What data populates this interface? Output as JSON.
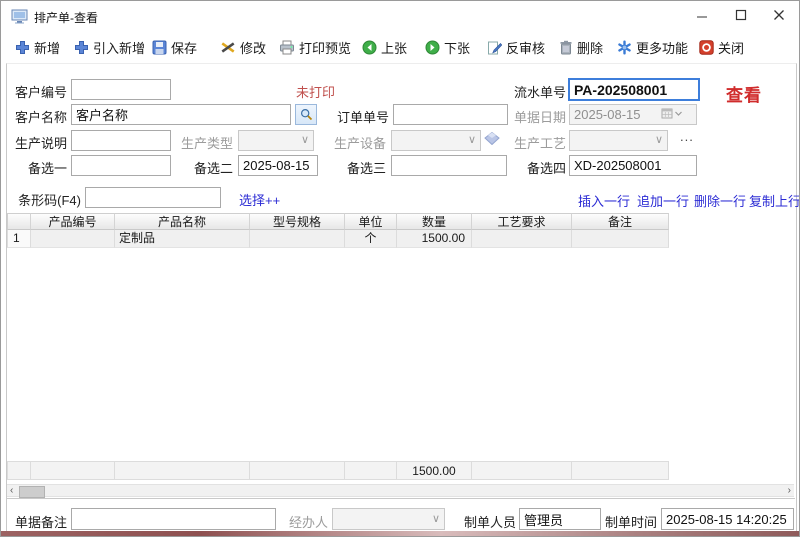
{
  "window": {
    "title": "排产单-查看"
  },
  "toolbar": {
    "items": [
      {
        "label": "新增"
      },
      {
        "label": "引入新增"
      },
      {
        "label": "保存"
      },
      {
        "label": "修改"
      },
      {
        "label": "打印预览"
      },
      {
        "label": "上张"
      },
      {
        "label": "下张"
      },
      {
        "label": "反审核"
      },
      {
        "label": "删除"
      },
      {
        "label": "更多功能"
      },
      {
        "label": "关闭"
      }
    ]
  },
  "status": {
    "not_printed": "未打印",
    "view_badge": "查看"
  },
  "form": {
    "customer_no_label": "客户编号",
    "customer_no_value": "",
    "customer_name_label": "客户名称",
    "customer_name_value": "客户名称",
    "order_no_label": "订单单号",
    "order_no_value": "",
    "serial_no_label": "流水单号",
    "serial_no_value": "PA-202508001",
    "doc_date_label": "单据日期",
    "doc_date_value": "2025-08-15",
    "prod_desc_label": "生产说明",
    "prod_desc_value": "",
    "prod_type_label": "生产类型",
    "prod_equip_label": "生产设备",
    "prod_craft_label": "生产工艺",
    "ellipsis_button": "...",
    "option1_label": "备选一",
    "option1_value": "",
    "option2_label": "备选二",
    "option2_value": "2025-08-15",
    "option3_label": "备选三",
    "option3_value": "",
    "option4_label": "备选四",
    "option4_value": "XD-202508001",
    "barcode_label": "条形码(F4)",
    "barcode_value": "",
    "select_plus_link": "选择++"
  },
  "row_links": {
    "insert": "插入一行",
    "append": "追加一行",
    "delete": "删除一行",
    "copy_up": "复制上行"
  },
  "table": {
    "columns": [
      "产品编号",
      "产品名称",
      "型号规格",
      "单位",
      "数量",
      "工艺要求",
      "备注"
    ],
    "rows": [
      {
        "no": "1",
        "code": "",
        "name": "定制品",
        "spec": "",
        "unit": "个",
        "qty": "1500.00",
        "craft": "",
        "remark": ""
      }
    ],
    "total_qty": "1500.00"
  },
  "footer": {
    "doc_remark_label": "单据备注",
    "doc_remark_value": "",
    "handler_label": "经办人",
    "handler_value": "",
    "creator_label": "制单人员",
    "creator_value": "管理员",
    "time_label": "制单时间",
    "time_value": "2025-08-15 14:20:25"
  },
  "colors": {
    "accent_focus_border": "#3d7edb",
    "alert_red": "#d02c2c",
    "not_printed_red": "#c0504d",
    "link_blue": "#2b2bd4"
  }
}
